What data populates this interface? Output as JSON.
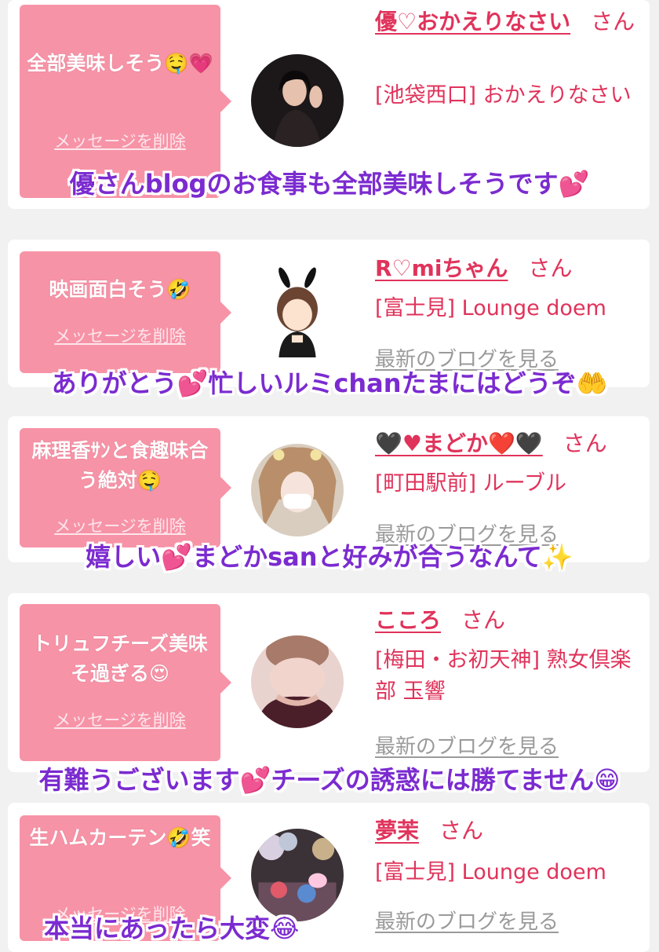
{
  "entries": [
    {
      "message": "全部美味しそう🤤💗",
      "delete_label": "メッセージを削除",
      "name": "優♡おかえりなさい",
      "honorific": "さん",
      "shop": "[池袋西口] おかえりなさい",
      "blog_link": "最新のブログを見る",
      "overlay": "優さんblogのお食事も全部美味しそうです💕"
    },
    {
      "message": "映画面白そう🤣",
      "delete_label": "メッセージを削除",
      "name": "R♡miちゃん",
      "honorific": "さん",
      "shop": "[富士見] Lounge doem",
      "blog_link": "最新のブログを見る",
      "overlay": "ありがとう💕忙しいルミchanたまにはどうぞ🤲"
    },
    {
      "message": "麻理香ｻﾝと食趣味合う絶対🤤",
      "delete_label": "メッセージを削除",
      "name": "🖤♥まどか❤️🖤",
      "honorific": "さん",
      "shop": "[町田駅前] ルーブル",
      "blog_link": "最新のブログを見る",
      "overlay": "嬉しい💕まどかsanと好みが合うなんて✨"
    },
    {
      "message": "トリュフチーズ美味そ過ぎる😍",
      "delete_label": "メッセージを削除",
      "name": "こころ",
      "honorific": "さん",
      "shop": "[梅田・お初天神] 熟女倶楽部 玉響",
      "blog_link": "最新のブログを見る",
      "overlay": "有難うございます💕チーズの誘惑には勝てません😁"
    },
    {
      "message": "生ハムカーテン🤣笑",
      "delete_label": "メッセージを削除",
      "name": "夢茉",
      "honorific": "さん",
      "shop": "[富士見] Lounge doem",
      "blog_link": "最新のブログを見る",
      "overlay": "本当にあったら大変😂"
    }
  ],
  "colors": {
    "bubble": "#f793a7",
    "name": "#e0335b",
    "overlay_text": "#7b2bd0",
    "blog_link": "#9a9a9a"
  }
}
